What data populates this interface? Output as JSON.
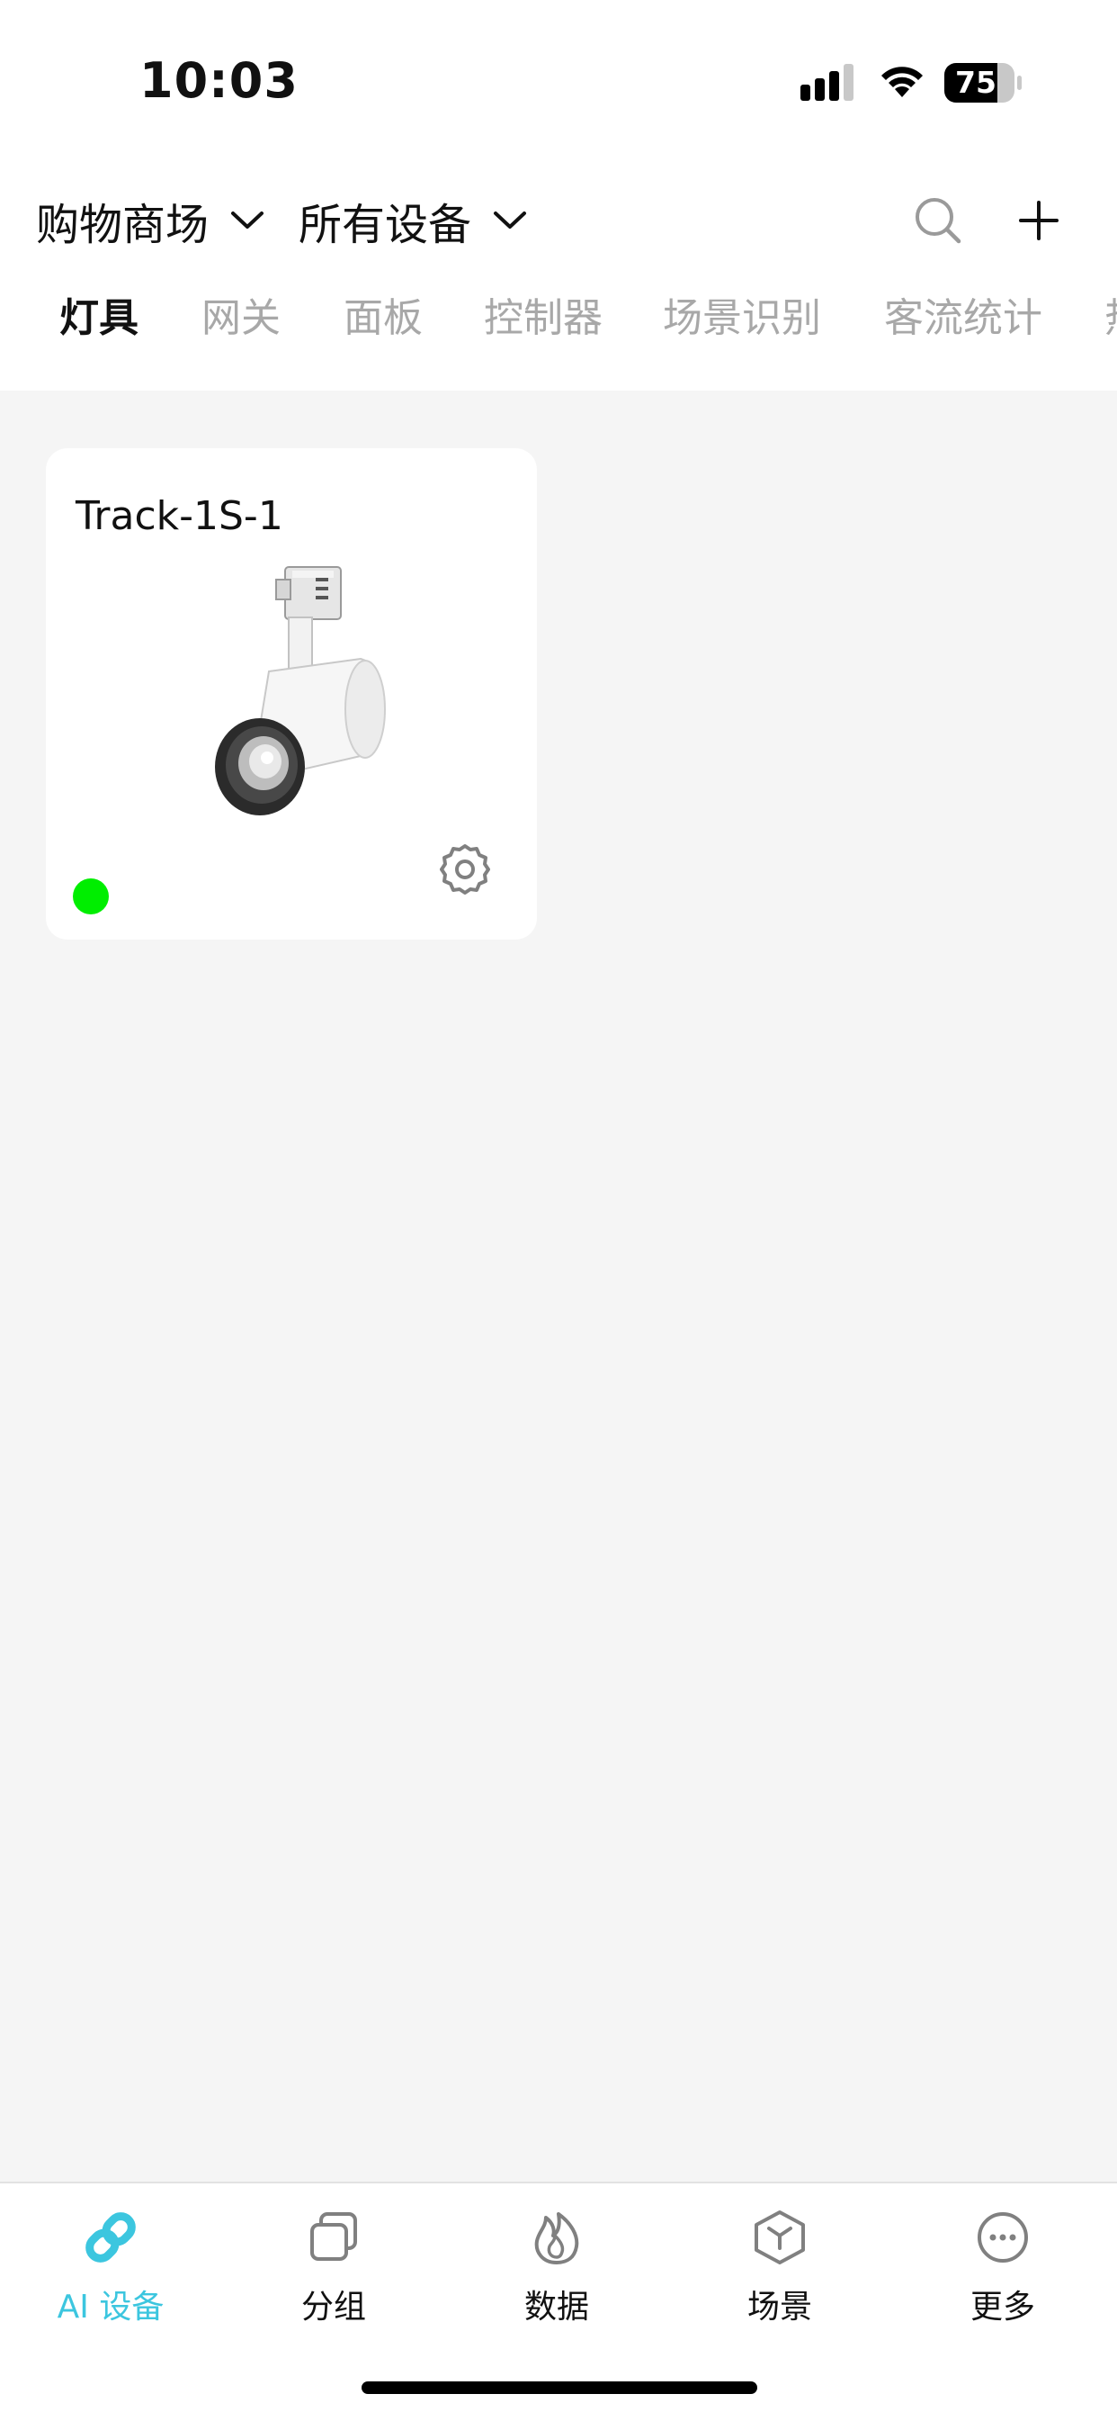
{
  "status_bar": {
    "time": "10:03",
    "battery_level": "75",
    "battery_fraction": 0.75
  },
  "filters": {
    "location": "购物商场",
    "device_scope": "所有设备",
    "search_icon": "search-icon",
    "add_icon": "plus-icon"
  },
  "category_tabs": [
    {
      "label": "灯具",
      "active": true
    },
    {
      "label": "网关",
      "active": false
    },
    {
      "label": "面板",
      "active": false
    },
    {
      "label": "控制器",
      "active": false
    },
    {
      "label": "场景识别",
      "active": false
    },
    {
      "label": "客流统计",
      "active": false
    },
    {
      "label": "热",
      "active": false
    }
  ],
  "devices": [
    {
      "name": "Track-1S-1",
      "online": true,
      "status_color": "#00ee00",
      "image": "track-spotlight"
    }
  ],
  "tab_bar": [
    {
      "label": "AI 设备",
      "icon": "link-icon",
      "active": true
    },
    {
      "label": "分组",
      "icon": "copy-icon",
      "active": false
    },
    {
      "label": "数据",
      "icon": "flame-icon",
      "active": false
    },
    {
      "label": "场景",
      "icon": "cube-icon",
      "active": false
    },
    {
      "label": "更多",
      "icon": "more-icon",
      "active": false
    }
  ],
  "colors": {
    "accent": "#3cc6df",
    "online": "#00ee00",
    "background": "#f5f5f5",
    "inactive_tab": "#a8a8a8"
  }
}
